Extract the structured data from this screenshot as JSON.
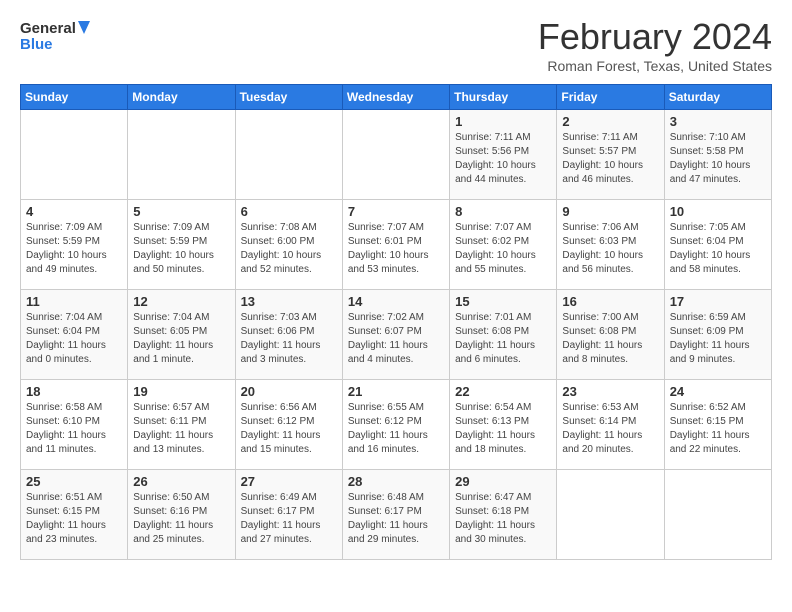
{
  "header": {
    "logo_line1": "General",
    "logo_line2": "Blue",
    "month_title": "February 2024",
    "location": "Roman Forest, Texas, United States"
  },
  "weekdays": [
    "Sunday",
    "Monday",
    "Tuesday",
    "Wednesday",
    "Thursday",
    "Friday",
    "Saturday"
  ],
  "weeks": [
    [
      {
        "day": "",
        "info": ""
      },
      {
        "day": "",
        "info": ""
      },
      {
        "day": "",
        "info": ""
      },
      {
        "day": "",
        "info": ""
      },
      {
        "day": "1",
        "info": "Sunrise: 7:11 AM\nSunset: 5:56 PM\nDaylight: 10 hours\nand 44 minutes."
      },
      {
        "day": "2",
        "info": "Sunrise: 7:11 AM\nSunset: 5:57 PM\nDaylight: 10 hours\nand 46 minutes."
      },
      {
        "day": "3",
        "info": "Sunrise: 7:10 AM\nSunset: 5:58 PM\nDaylight: 10 hours\nand 47 minutes."
      }
    ],
    [
      {
        "day": "4",
        "info": "Sunrise: 7:09 AM\nSunset: 5:59 PM\nDaylight: 10 hours\nand 49 minutes."
      },
      {
        "day": "5",
        "info": "Sunrise: 7:09 AM\nSunset: 5:59 PM\nDaylight: 10 hours\nand 50 minutes."
      },
      {
        "day": "6",
        "info": "Sunrise: 7:08 AM\nSunset: 6:00 PM\nDaylight: 10 hours\nand 52 minutes."
      },
      {
        "day": "7",
        "info": "Sunrise: 7:07 AM\nSunset: 6:01 PM\nDaylight: 10 hours\nand 53 minutes."
      },
      {
        "day": "8",
        "info": "Sunrise: 7:07 AM\nSunset: 6:02 PM\nDaylight: 10 hours\nand 55 minutes."
      },
      {
        "day": "9",
        "info": "Sunrise: 7:06 AM\nSunset: 6:03 PM\nDaylight: 10 hours\nand 56 minutes."
      },
      {
        "day": "10",
        "info": "Sunrise: 7:05 AM\nSunset: 6:04 PM\nDaylight: 10 hours\nand 58 minutes."
      }
    ],
    [
      {
        "day": "11",
        "info": "Sunrise: 7:04 AM\nSunset: 6:04 PM\nDaylight: 11 hours\nand 0 minutes."
      },
      {
        "day": "12",
        "info": "Sunrise: 7:04 AM\nSunset: 6:05 PM\nDaylight: 11 hours\nand 1 minute."
      },
      {
        "day": "13",
        "info": "Sunrise: 7:03 AM\nSunset: 6:06 PM\nDaylight: 11 hours\nand 3 minutes."
      },
      {
        "day": "14",
        "info": "Sunrise: 7:02 AM\nSunset: 6:07 PM\nDaylight: 11 hours\nand 4 minutes."
      },
      {
        "day": "15",
        "info": "Sunrise: 7:01 AM\nSunset: 6:08 PM\nDaylight: 11 hours\nand 6 minutes."
      },
      {
        "day": "16",
        "info": "Sunrise: 7:00 AM\nSunset: 6:08 PM\nDaylight: 11 hours\nand 8 minutes."
      },
      {
        "day": "17",
        "info": "Sunrise: 6:59 AM\nSunset: 6:09 PM\nDaylight: 11 hours\nand 9 minutes."
      }
    ],
    [
      {
        "day": "18",
        "info": "Sunrise: 6:58 AM\nSunset: 6:10 PM\nDaylight: 11 hours\nand 11 minutes."
      },
      {
        "day": "19",
        "info": "Sunrise: 6:57 AM\nSunset: 6:11 PM\nDaylight: 11 hours\nand 13 minutes."
      },
      {
        "day": "20",
        "info": "Sunrise: 6:56 AM\nSunset: 6:12 PM\nDaylight: 11 hours\nand 15 minutes."
      },
      {
        "day": "21",
        "info": "Sunrise: 6:55 AM\nSunset: 6:12 PM\nDaylight: 11 hours\nand 16 minutes."
      },
      {
        "day": "22",
        "info": "Sunrise: 6:54 AM\nSunset: 6:13 PM\nDaylight: 11 hours\nand 18 minutes."
      },
      {
        "day": "23",
        "info": "Sunrise: 6:53 AM\nSunset: 6:14 PM\nDaylight: 11 hours\nand 20 minutes."
      },
      {
        "day": "24",
        "info": "Sunrise: 6:52 AM\nSunset: 6:15 PM\nDaylight: 11 hours\nand 22 minutes."
      }
    ],
    [
      {
        "day": "25",
        "info": "Sunrise: 6:51 AM\nSunset: 6:15 PM\nDaylight: 11 hours\nand 23 minutes."
      },
      {
        "day": "26",
        "info": "Sunrise: 6:50 AM\nSunset: 6:16 PM\nDaylight: 11 hours\nand 25 minutes."
      },
      {
        "day": "27",
        "info": "Sunrise: 6:49 AM\nSunset: 6:17 PM\nDaylight: 11 hours\nand 27 minutes."
      },
      {
        "day": "28",
        "info": "Sunrise: 6:48 AM\nSunset: 6:17 PM\nDaylight: 11 hours\nand 29 minutes."
      },
      {
        "day": "29",
        "info": "Sunrise: 6:47 AM\nSunset: 6:18 PM\nDaylight: 11 hours\nand 30 minutes."
      },
      {
        "day": "",
        "info": ""
      },
      {
        "day": "",
        "info": ""
      }
    ]
  ]
}
